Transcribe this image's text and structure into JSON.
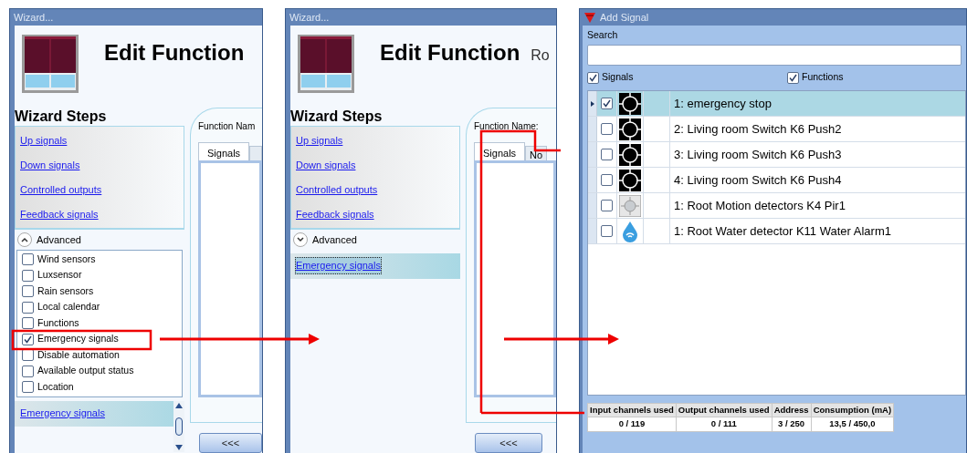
{
  "panels": [
    {
      "kind": "wizard",
      "title": "Wizard...",
      "heading": "Edit Function",
      "steps_title": "Wizard Steps",
      "steps": [
        "Up signals",
        "Down signals",
        "Controlled outputs",
        "Feedback signals"
      ],
      "advanced": {
        "label": "Advanced",
        "expanded": true,
        "options": [
          {
            "label": "Wind sensors",
            "checked": false
          },
          {
            "label": "Luxsensor",
            "checked": false
          },
          {
            "label": "Rain sensors",
            "checked": false
          },
          {
            "label": "Local calendar",
            "checked": false
          },
          {
            "label": "Functions",
            "checked": false
          },
          {
            "label": "Emergency signals",
            "checked": true
          },
          {
            "label": "Disable automation",
            "checked": false
          },
          {
            "label": "Available output status",
            "checked": false
          },
          {
            "label": "Location",
            "checked": false
          }
        ]
      },
      "extra_step": {
        "label": "Emergency signals",
        "focused": false
      },
      "function_name_label": "Function Nam",
      "tabs": [
        {
          "label": "Signals",
          "selected": true
        },
        {
          "selected": false
        }
      ],
      "back_button": "<<<"
    },
    {
      "kind": "wizard",
      "title": "Wizard...",
      "heading": "Edit Function",
      "heading_extra": "Ro",
      "steps_title": "Wizard Steps",
      "steps": [
        "Up signals",
        "Down signals",
        "Controlled outputs",
        "Feedback signals"
      ],
      "advanced": {
        "label": "Advanced",
        "expanded": false
      },
      "extra_step": {
        "label": "Emergency signals",
        "focused": true
      },
      "function_name_label": "Function Name:",
      "tabs": [
        {
          "label": "Signals",
          "selected": true
        },
        {
          "label": "No",
          "selected": false
        }
      ],
      "back_button": "<<<"
    },
    {
      "kind": "add_signal",
      "title": "Add Signal",
      "search_label": "Search",
      "filters": [
        {
          "label": "Signals",
          "checked": true
        },
        {
          "label": "Functions",
          "checked": true
        }
      ],
      "rows": [
        {
          "kind": "push",
          "text": "1: emergency stop",
          "checked": true,
          "selected": true
        },
        {
          "kind": "push",
          "text": "2: Living room Switch K6 Push2",
          "checked": false,
          "selected": false
        },
        {
          "kind": "push",
          "text": "3: Living room Switch K6 Push3",
          "checked": false,
          "selected": false
        },
        {
          "kind": "push",
          "text": "4: Living room Switch K6 Push4",
          "checked": false,
          "selected": false
        },
        {
          "kind": "motion",
          "text": "1: Root Motion detectors K4 Pir1",
          "checked": false,
          "selected": false
        },
        {
          "kind": "water",
          "text": "1: Root Water detector K11 Water Alarm1",
          "checked": false,
          "selected": false
        }
      ],
      "status": {
        "columns": [
          "Input channels used",
          "Output channels used",
          "Address",
          "Consumption (mA)"
        ],
        "values": [
          "0 / 119",
          "0 / 111",
          "3 / 250",
          "13,5 / 450,0"
        ]
      }
    }
  ]
}
